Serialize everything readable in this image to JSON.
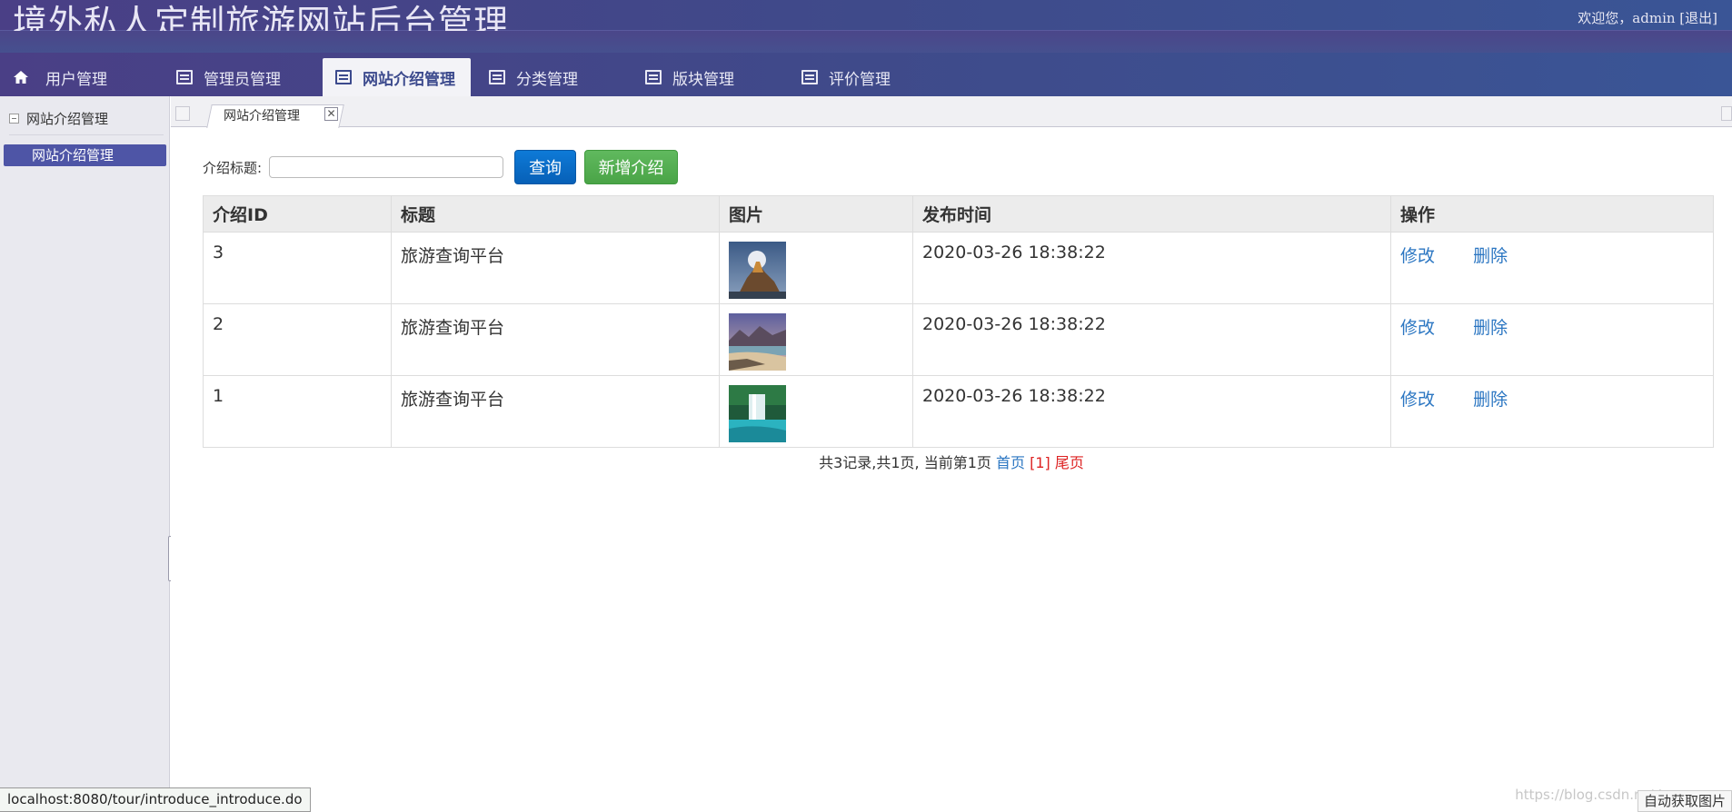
{
  "header": {
    "site_title": "境外私人定制旅游网站后台管理",
    "welcome_text": "欢迎您，admin [退出]"
  },
  "nav": {
    "items": [
      {
        "label": "用户管理",
        "icon": "home-icon"
      },
      {
        "label": "管理员管理",
        "icon": "list-icon"
      },
      {
        "label": "网站介绍管理",
        "icon": "list-icon",
        "active": true
      },
      {
        "label": "分类管理",
        "icon": "list-icon"
      },
      {
        "label": "版块管理",
        "icon": "list-icon"
      },
      {
        "label": "评价管理",
        "icon": "list-icon"
      }
    ]
  },
  "sidebar": {
    "group_title": "网站介绍管理",
    "items": [
      {
        "label": "网站介绍管理",
        "selected": true
      }
    ]
  },
  "tabs": [
    {
      "label": "网站介绍管理",
      "closable": true
    }
  ],
  "search": {
    "label": "介绍标题:",
    "value": "",
    "placeholder": "",
    "query_button": "查询",
    "add_button": "新增介绍"
  },
  "table": {
    "columns": [
      "介绍ID",
      "标题",
      "图片",
      "发布时间",
      "操作"
    ],
    "rows": [
      {
        "id": "3",
        "title": "旅游查询平台",
        "image": "mountain-castle-image",
        "time": "2020-03-26 18:38:22",
        "edit": "修改",
        "delete": "删除"
      },
      {
        "id": "2",
        "title": "旅游查询平台",
        "image": "beach-image",
        "time": "2020-03-26 18:38:22",
        "edit": "修改",
        "delete": "删除"
      },
      {
        "id": "1",
        "title": "旅游查询平台",
        "image": "waterfall-image",
        "time": "2020-03-26 18:38:22",
        "edit": "修改",
        "delete": "删除"
      }
    ]
  },
  "pager": {
    "summary": "共3记录,共1页, 当前第1页",
    "first": "首页",
    "current": "[1]",
    "last": "尾页"
  },
  "statusbar": {
    "url": "localhost:8080/tour/introduce_introduce.do"
  },
  "watermark": "https://blog.csdn.net/...",
  "corner_button": "自动获取图片",
  "colors": {
    "header_bg": "#453f86",
    "active_tab_text": "#3c4a8d",
    "sidebar_selected": "#4e55a6",
    "query_button": "#0760b7",
    "add_button": "#4aa447",
    "link": "#2b76c2",
    "pager_current": "#dd2222"
  }
}
